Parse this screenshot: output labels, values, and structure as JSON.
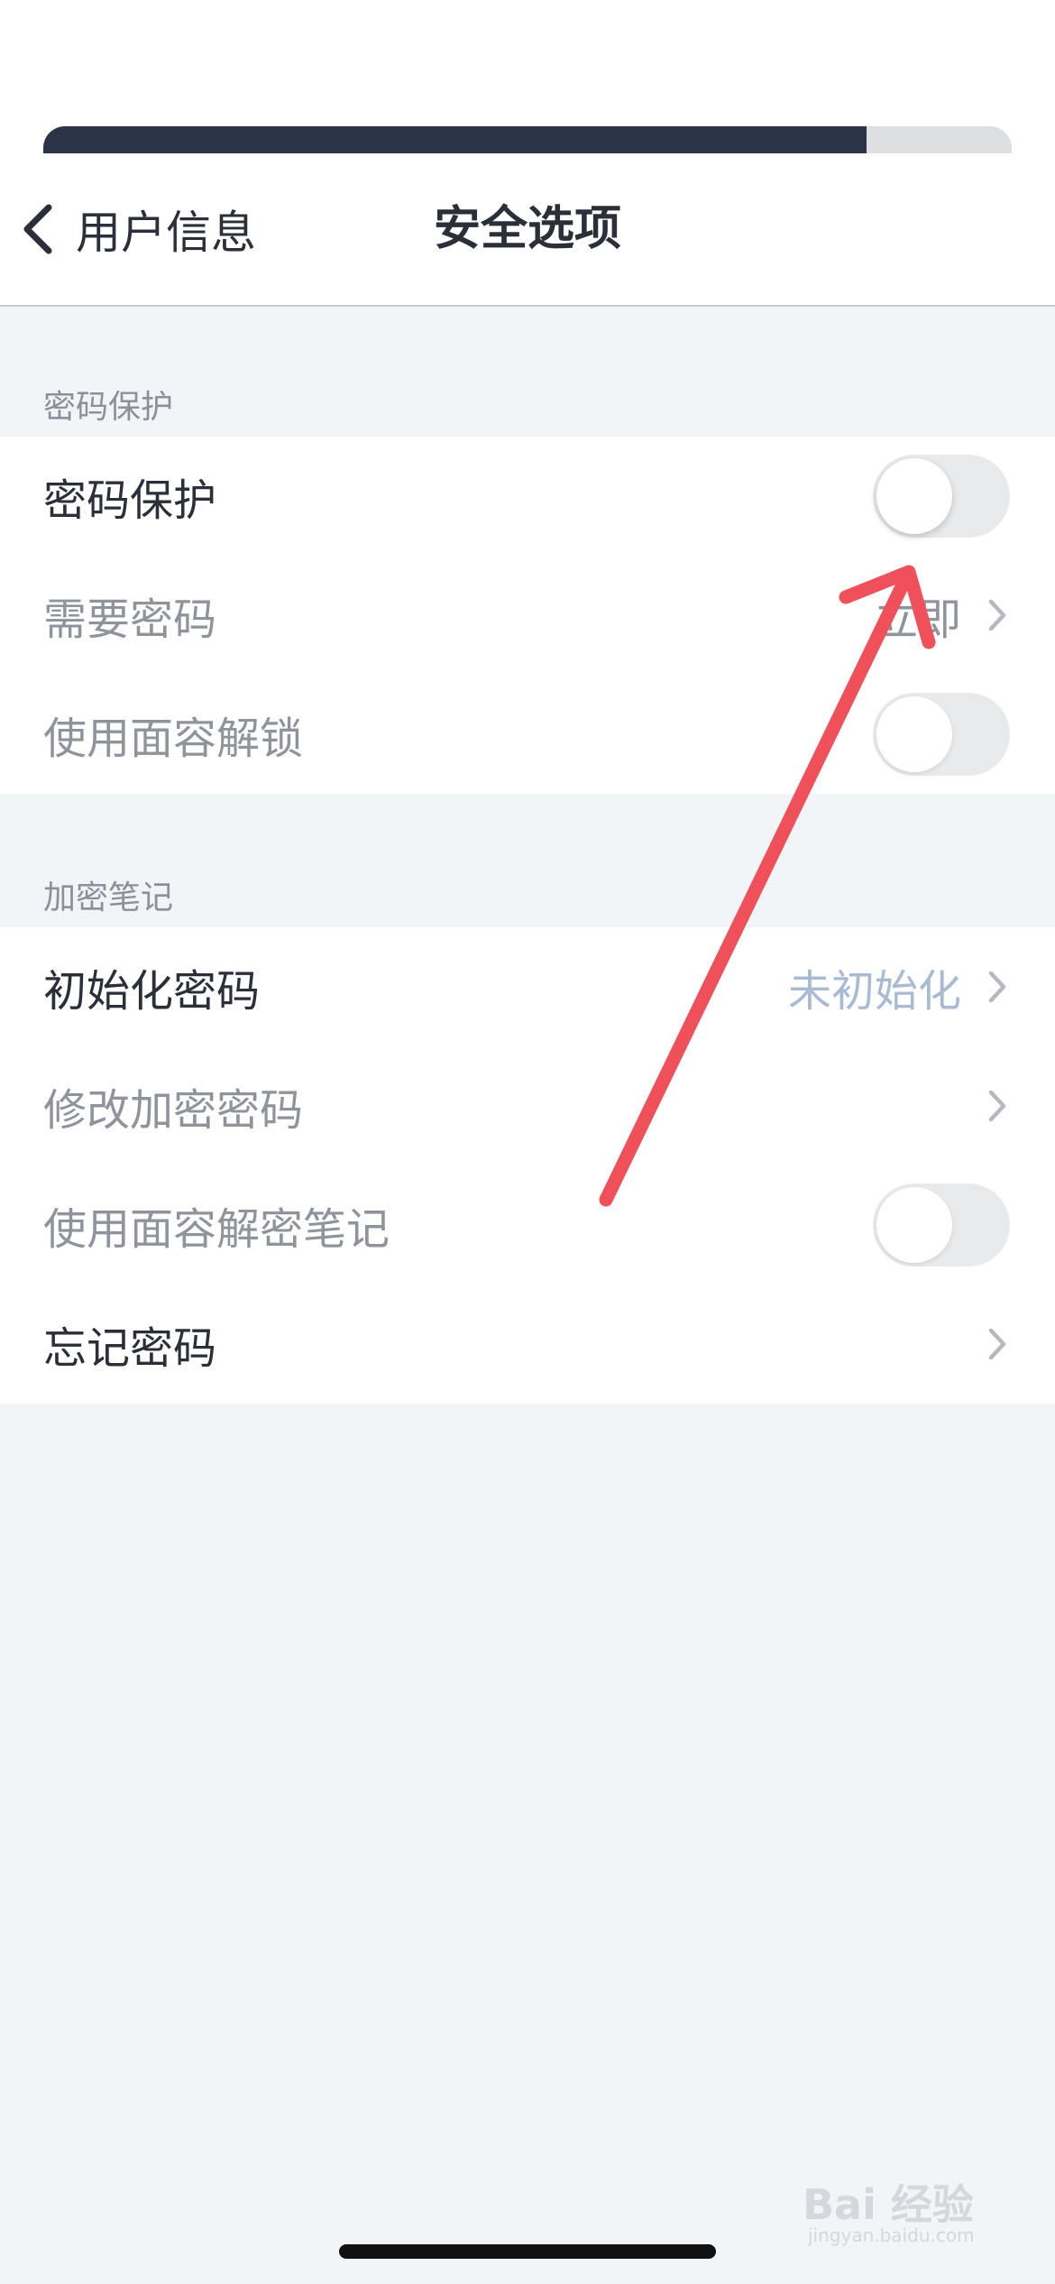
{
  "progress": {
    "fraction": 0.85
  },
  "nav": {
    "back_label": "用户信息",
    "title": "安全选项"
  },
  "sections": [
    {
      "title": "密码保护",
      "rows": [
        {
          "label": "密码保护",
          "control": "toggle",
          "on": false
        },
        {
          "label": "需要密码",
          "control": "chevron",
          "value": "立即"
        },
        {
          "label": "使用面容解锁",
          "control": "toggle",
          "on": false
        }
      ]
    },
    {
      "title": "加密笔记",
      "rows": [
        {
          "label": "初始化密码",
          "control": "chevron",
          "value": "未初始化"
        },
        {
          "label": "修改加密密码",
          "control": "chevron",
          "value": ""
        },
        {
          "label": "使用面容解密笔记",
          "control": "toggle",
          "on": false
        },
        {
          "label": "忘记密码",
          "control": "chevron",
          "value": ""
        }
      ]
    }
  ],
  "watermark": {
    "brand": "Bai 经验",
    "site": "jingyan.baidu.com"
  },
  "colors": {
    "accent_value": "#a9bbd3",
    "annotation_arrow": "#f0505a",
    "progress_fill": "#2a3446"
  },
  "icons": [
    "chevron-left-icon",
    "chevron-right-icon",
    "annotation-arrow-icon"
  ]
}
